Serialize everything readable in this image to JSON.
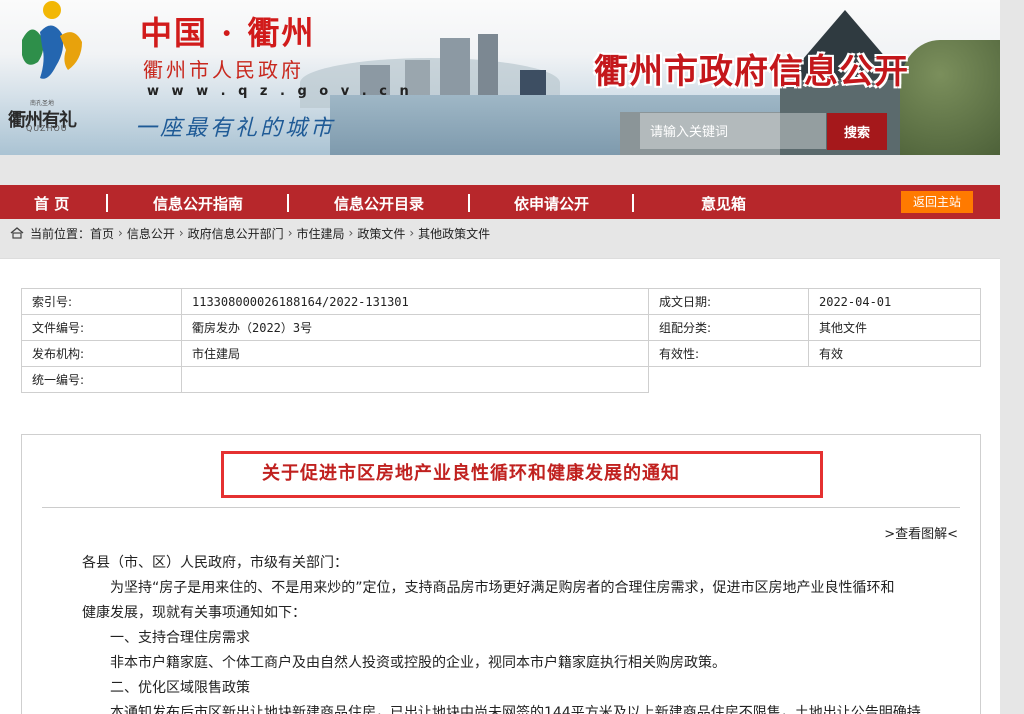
{
  "header": {
    "logo_text": "衢州有礼",
    "logo_sub": "QUZHOU",
    "logo_small": "南孔圣地",
    "site_title": "中国 · 衢州",
    "gov_name": "衢州市人民政府",
    "gov_url": "w w w . q z . g o v . c n",
    "slogan": "一座最有礼的城市",
    "portal_title": "衢州市政府信息公开",
    "search_placeholder": "请输入关键词",
    "search_button": "搜索"
  },
  "nav": {
    "items": [
      "首 页",
      "信息公开指南",
      "信息公开目录",
      "依申请公开",
      "意见箱"
    ],
    "home_button": "返回主站"
  },
  "breadcrumb": {
    "label": "当前位置：",
    "items": [
      "首页",
      "信息公开",
      "政府信息公开部门",
      "市住建局",
      "政策文件",
      "其他政策文件"
    ]
  },
  "meta": {
    "index_label": "索引号:",
    "index_value": "113308000026188164/2022-131301",
    "date_label": "成文日期:",
    "date_value": "2022-04-01",
    "docno_label": "文件编号:",
    "docno_value": "衢房发办（2022）3号",
    "category_label": "组配分类:",
    "category_value": "其他文件",
    "org_label": "发布机构:",
    "org_value": "市住建局",
    "validity_label": "有效性:",
    "validity_value": "有效",
    "unified_label": "统一编号:",
    "unified_value": ""
  },
  "article": {
    "title": "关于促进市区房地产业良性循环和健康发展的通知",
    "graphic_link": ">查看图解<",
    "salutation": "各县（市、区）人民政府，市级有关部门：",
    "p1_line1": "为坚持“房子是用来住的、不是用来炒的”定位，支持商品房市场更好满足购房者的合理住房需求，促进市区房地产业良性循环和",
    "p1_line2": "健康发展，现就有关事项通知如下：",
    "h1": "一、支持合理住房需求",
    "p2": "非本市户籍家庭、个体工商户及由自然人投资或控股的企业，视同本市户籍家庭执行相关购房政策。",
    "h2": "二、优化区域限售政策",
    "p3": "本通知发布后市区新出让地块新建商品住房，已出让地块中尚未网签的144平方米及以上新建商品住房不限售，土地出让公告明确持"
  },
  "colors": {
    "brand_red": "#b7272b",
    "title_red": "#c0211f",
    "home_button": "#ff7a00"
  }
}
